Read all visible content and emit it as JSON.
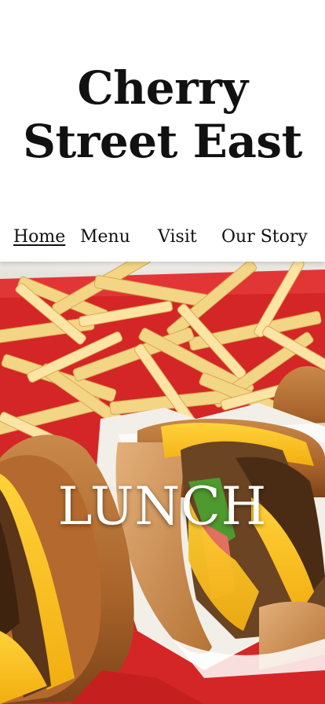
{
  "site": {
    "title_line1": "Cherry",
    "title_line2": "Street East"
  },
  "nav": {
    "items": [
      {
        "label": "Home",
        "active": true
      },
      {
        "label": "Menu",
        "active": false
      },
      {
        "label": "Visit",
        "active": false
      },
      {
        "label": "Our Story",
        "active": false
      }
    ]
  },
  "hero": {
    "label": "LUNCH",
    "image": "burgers-and-fries-photo"
  },
  "colors": {
    "text": "#111111",
    "header_bg": "#ffffff",
    "tray_red": "#d82a2a",
    "hero_text": "#ffffff"
  }
}
